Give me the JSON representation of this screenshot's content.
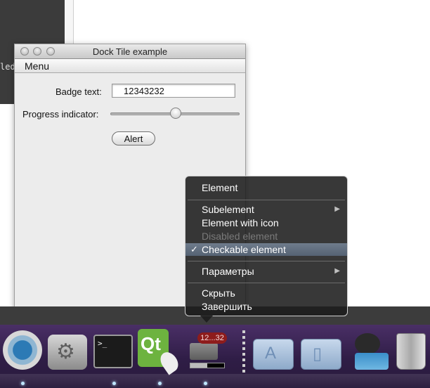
{
  "background_window": {
    "terminal_fragment_text": "led"
  },
  "dock_tile_window": {
    "title": "Dock Tile example",
    "menubar": {
      "menu_label": "Menu"
    },
    "badge_label": "Badge text:",
    "badge_value": "12343232",
    "progress_label": "Progress indicator:",
    "progress_slider_level": 0.5,
    "alert_button": "Alert"
  },
  "context_menu": {
    "items": [
      {
        "label": "Element",
        "state": "normal"
      },
      {
        "label": "Subelement",
        "state": "normal",
        "submenu": true
      },
      {
        "label": "Element with icon",
        "state": "normal"
      },
      {
        "label": "Disabled element",
        "state": "disabled"
      },
      {
        "label": "Checkable element",
        "state": "highlighted",
        "checked": true
      },
      {
        "label": "Параметры",
        "state": "normal",
        "submenu": true
      },
      {
        "label": "Скрыть",
        "state": "normal"
      },
      {
        "label": "Завершить",
        "state": "normal"
      }
    ],
    "check_glyph": "✓",
    "submenu_glyph": "▶"
  },
  "dock": {
    "badge_text": "12...32",
    "dock_progress_level": 0.5,
    "terminal_prompt": ">_",
    "qt_logo_text": "Qt",
    "icons": [
      {
        "name": "time-machine-icon"
      },
      {
        "name": "system-preferences-icon"
      },
      {
        "name": "terminal-icon"
      },
      {
        "name": "qt-creator-icon"
      },
      {
        "name": "dock-tile-example-icon"
      },
      {
        "name": "applications-folder-icon"
      },
      {
        "name": "documents-folder-icon"
      },
      {
        "name": "github-octocat-icon"
      },
      {
        "name": "trash-icon"
      }
    ]
  },
  "colors": {
    "dock_badge_red": "#8e1c1c",
    "menu_highlight": "#6f7c8c",
    "qt_green": "#6db33f",
    "dock_purple": "#4a2f66"
  }
}
